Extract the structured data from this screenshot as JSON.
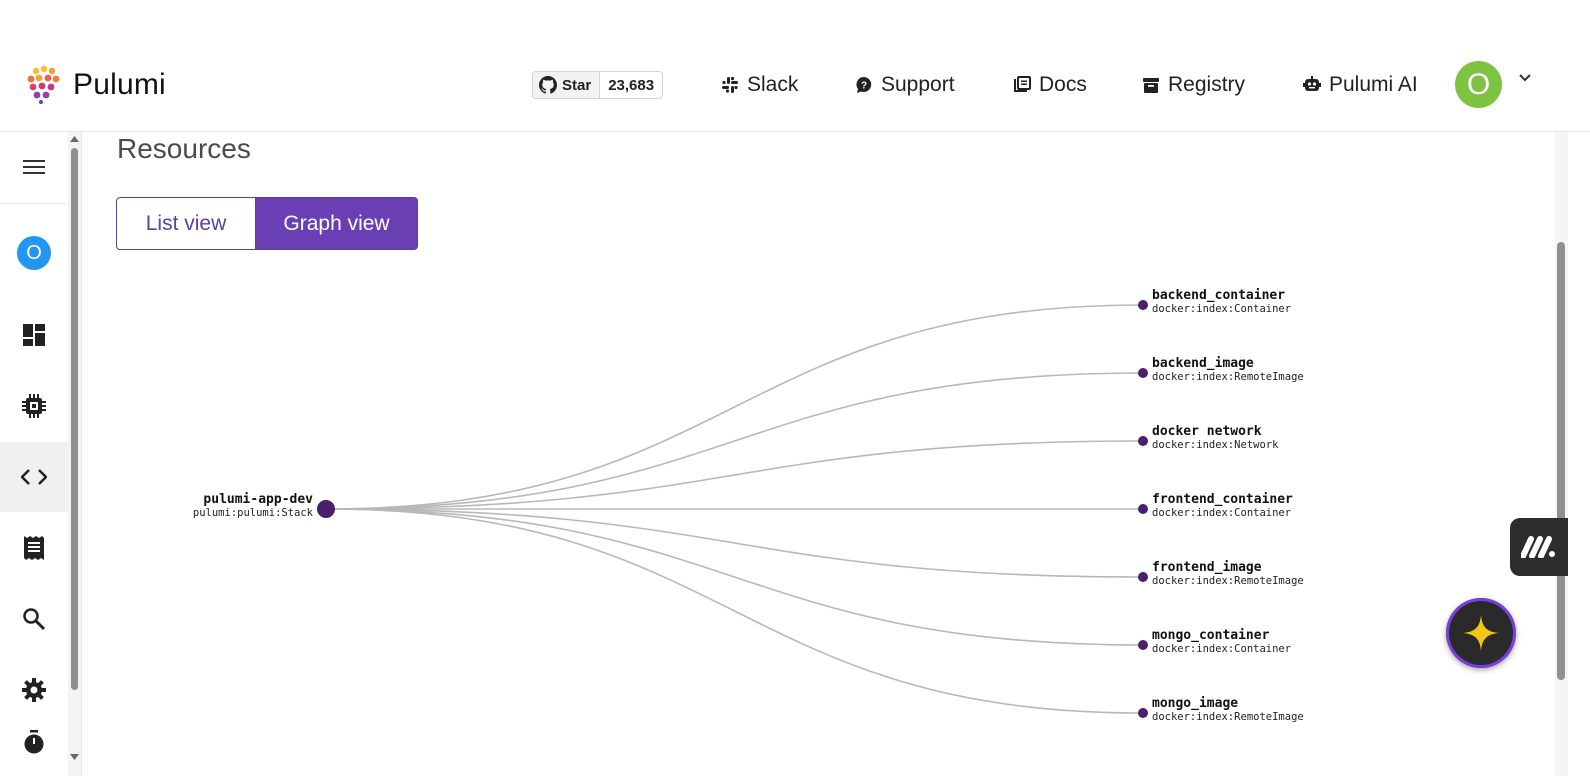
{
  "header": {
    "brand": "Pulumi",
    "github": {
      "star_label": "Star",
      "star_count": "23,683"
    },
    "nav": [
      {
        "id": "slack",
        "label": "Slack"
      },
      {
        "id": "support",
        "label": "Support"
      },
      {
        "id": "docs",
        "label": "Docs"
      },
      {
        "id": "registry",
        "label": "Registry"
      },
      {
        "id": "ai",
        "label": "Pulumi AI"
      }
    ],
    "avatar_initial": "O"
  },
  "sidebar": {
    "org_initial": "O",
    "items": [
      "menu-icon",
      "org-avatar",
      "dashboard-icon",
      "chip-icon",
      "code-icon",
      "receipt-icon",
      "search-icon",
      "gear-icon",
      "timer-icon"
    ]
  },
  "main": {
    "title": "Resources",
    "toggle": {
      "list_label": "List view",
      "graph_label": "Graph view",
      "selected": "Graph view"
    }
  },
  "graph": {
    "root": {
      "name": "pulumi-app-dev",
      "type": "pulumi:pulumi:Stack"
    },
    "children": [
      {
        "name": "backend_container",
        "type": "docker:index:Container"
      },
      {
        "name": "backend_image",
        "type": "docker:index:RemoteImage"
      },
      {
        "name": "docker network",
        "type": "docker:index:Network"
      },
      {
        "name": "frontend_container",
        "type": "docker:index:Container"
      },
      {
        "name": "frontend_image",
        "type": "docker:index:RemoteImage"
      },
      {
        "name": "mongo_container",
        "type": "docker:index:Container"
      },
      {
        "name": "mongo_image",
        "type": "docker:index:RemoteImage"
      }
    ]
  },
  "colors": {
    "accent": "#6a3fb3",
    "node": "#4a1f6e",
    "edge": "#b8b8b8",
    "avatar": "#7ec242",
    "org": "#2196f3"
  }
}
